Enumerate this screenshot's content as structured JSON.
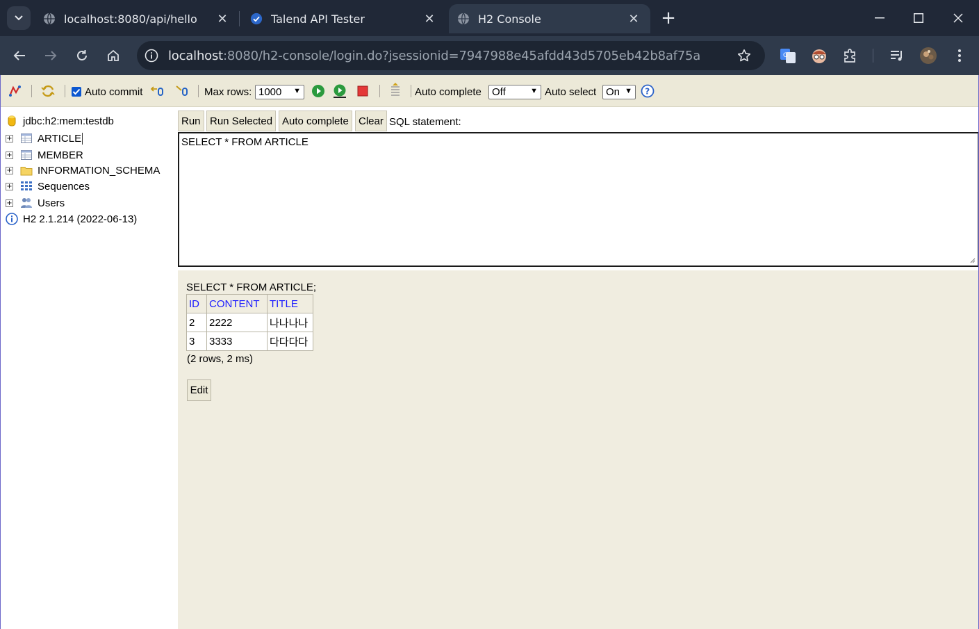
{
  "browser": {
    "tabs": [
      {
        "title": "localhost:8080/api/hello",
        "active": false
      },
      {
        "title": "Talend API Tester",
        "active": false
      },
      {
        "title": "H2 Console",
        "active": true
      }
    ],
    "url_host": "localhost",
    "url_rest": ":8080/h2-console/login.do?jsessionid=7947988e45afdd43d5705eb42b8af75a"
  },
  "h2_toolbar": {
    "auto_commit_label": "Auto commit",
    "auto_commit_checked": true,
    "max_rows_label": "Max rows:",
    "max_rows_value": "1000",
    "auto_complete_label": "Auto complete",
    "auto_complete_value": "Off",
    "auto_select_label": "Auto select",
    "auto_select_value": "On"
  },
  "tree": {
    "connection": "jdbc:h2:mem:testdb",
    "items": [
      {
        "label": "ARTICLE",
        "icon": "table-icon"
      },
      {
        "label": "MEMBER",
        "icon": "table-icon"
      },
      {
        "label": "INFORMATION_SCHEMA",
        "icon": "folder-icon"
      },
      {
        "label": "Sequences",
        "icon": "sequences-icon"
      },
      {
        "label": "Users",
        "icon": "users-icon"
      }
    ],
    "version": "H2 2.1.214 (2022-06-13)"
  },
  "query": {
    "buttons": {
      "run": "Run",
      "run_selected": "Run Selected",
      "auto_complete": "Auto complete",
      "clear": "Clear"
    },
    "sql_label": "SQL statement:",
    "sql_text": "SELECT * FROM ARTICLE"
  },
  "result": {
    "statement": "SELECT * FROM ARTICLE;",
    "columns": [
      "ID",
      "CONTENT",
      "TITLE"
    ],
    "rows": [
      [
        "2",
        "2222",
        "나나나나"
      ],
      [
        "3",
        "3333",
        "다다다다"
      ]
    ],
    "summary": "(2 rows, 2 ms)",
    "edit_label": "Edit"
  }
}
